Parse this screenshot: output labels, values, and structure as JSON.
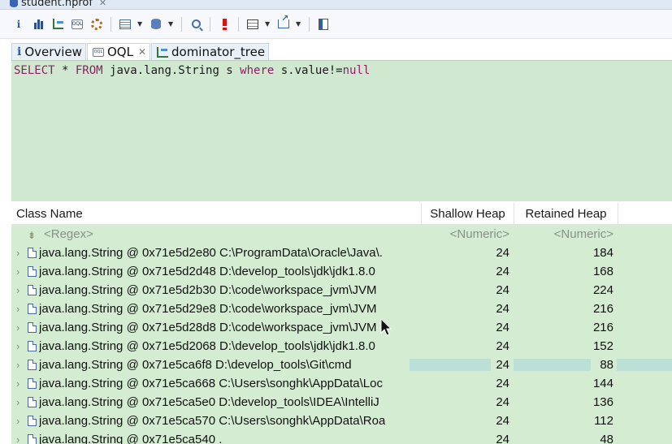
{
  "editor_tab": {
    "title": "student.hprof"
  },
  "toolbar": {
    "buttons": [
      "info-icon",
      "histogram-icon",
      "dominator-tree-icon",
      "oql-icon",
      "gear-icon",
      "list-icon",
      "database-icon",
      "search-icon",
      "warning-icon",
      "grid-icon",
      "export-icon",
      "calculator-icon"
    ],
    "info_label": "i"
  },
  "view_tabs": [
    {
      "label": "Overview",
      "icon": "info-icon",
      "active": false
    },
    {
      "label": "OQL",
      "icon": "oql-icon",
      "active": true
    },
    {
      "label": "dominator_tree",
      "icon": "dominator-tree-icon",
      "active": false
    }
  ],
  "query": {
    "select": "SELECT",
    "star": " * ",
    "from": "FROM",
    "class_part": " java.lang.String s ",
    "where": "where",
    "condition": " s.value!=",
    "null_kw": "null"
  },
  "table": {
    "columns": [
      "Class Name",
      "Shallow Heap",
      "Retained Heap"
    ],
    "filter": {
      "class_name": "<Regex>",
      "shallow": "<Numeric>",
      "retained": "<Numeric>"
    },
    "rows": [
      {
        "name": "java.lang.String @ 0x71e5d2e80  C:\\ProgramData\\Oracle\\Java\\.",
        "shallow": "24",
        "retained": "184"
      },
      {
        "name": "java.lang.String @ 0x71e5d2d48  D:\\develop_tools\\jdk\\jdk1.8.0",
        "shallow": "24",
        "retained": "168"
      },
      {
        "name": "java.lang.String @ 0x71e5d2b30  D:\\code\\workspace_jvm\\JVM",
        "shallow": "24",
        "retained": "224"
      },
      {
        "name": "java.lang.String @ 0x71e5d29e8  D:\\code\\workspace_jvm\\JVM",
        "shallow": "24",
        "retained": "216"
      },
      {
        "name": "java.lang.String @ 0x71e5d28d8  D:\\code\\workspace_jvm\\JVM",
        "shallow": "24",
        "retained": "216"
      },
      {
        "name": "java.lang.String @ 0x71e5d2068  D:\\develop_tools\\jdk\\jdk1.8.0",
        "shallow": "24",
        "retained": "152"
      },
      {
        "name": "java.lang.String @ 0x71e5ca6f8  D:\\develop_tools\\Git\\cmd",
        "shallow": "24",
        "retained": "88"
      },
      {
        "name": "java.lang.String @ 0x71e5ca668  C:\\Users\\songhk\\AppData\\Loc",
        "shallow": "24",
        "retained": "144"
      },
      {
        "name": "java.lang.String @ 0x71e5ca5e0  D:\\develop_tools\\IDEA\\IntelliJ",
        "shallow": "24",
        "retained": "136"
      },
      {
        "name": "java.lang.String @ 0x71e5ca570  C:\\Users\\songhk\\AppData\\Roa",
        "shallow": "24",
        "retained": "112"
      },
      {
        "name": "java.lang.String @ 0x71e5ca540  .",
        "shallow": "24",
        "retained": "48"
      }
    ]
  },
  "colors": {
    "query_bg": "#cfe8cf",
    "table_bg": "#d4ecd2",
    "keyword": "#8e1f67",
    "accent": "#2d5eaa"
  }
}
